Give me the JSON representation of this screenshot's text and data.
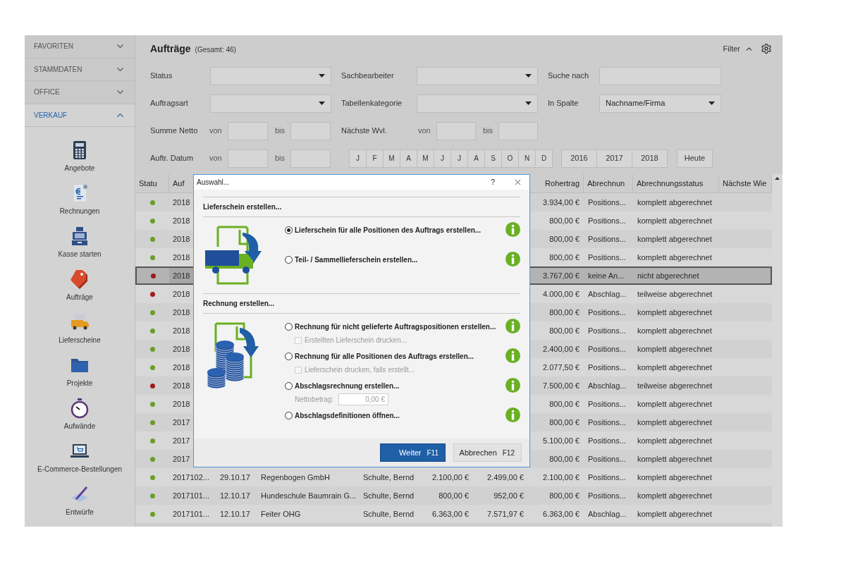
{
  "sidebar": {
    "sections": [
      {
        "label": "FAVORITEN",
        "expanded": false
      },
      {
        "label": "STAMMDATEN",
        "expanded": false
      },
      {
        "label": "OFFICE",
        "expanded": false
      },
      {
        "label": "VERKAUF",
        "expanded": true,
        "items": [
          {
            "label": "Angebote"
          },
          {
            "label": "Rechnungen"
          },
          {
            "label": "Kasse starten"
          },
          {
            "label": "Aufträge"
          },
          {
            "label": "Lieferscheine"
          },
          {
            "label": "Projekte"
          },
          {
            "label": "Aufwände"
          },
          {
            "label": "E-Commerce-Bestellungen"
          },
          {
            "label": "Entwürfe"
          }
        ]
      }
    ]
  },
  "header": {
    "title": "Aufträge",
    "count": "(Gesamt: 46)",
    "filter_label": "Filter"
  },
  "filters": {
    "rows": [
      [
        {
          "kind": "select",
          "label": "Status"
        },
        {
          "kind": "select",
          "label": "Sachbearbeiter"
        },
        {
          "kind": "text",
          "label": "Suche nach"
        }
      ],
      [
        {
          "kind": "select",
          "label": "Auftragsart"
        },
        {
          "kind": "select",
          "label": "Tabellenkategorie"
        },
        {
          "kind": "select",
          "label": "In Spalte",
          "value": "Nachname/Firma"
        }
      ],
      [
        {
          "kind": "range",
          "label": "Summe Netto",
          "from": "von",
          "to": "bis"
        },
        {
          "kind": "range",
          "label": "Nächste Wvl.",
          "from": "von",
          "to": "bis"
        }
      ],
      [
        {
          "kind": "range",
          "label": "Auftr. Datum",
          "from": "von",
          "to": "bis"
        },
        {
          "kind": "months",
          "items": [
            "J",
            "F",
            "M",
            "A",
            "M",
            "J",
            "J",
            "A",
            "S",
            "O",
            "N",
            "D"
          ]
        },
        {
          "kind": "years",
          "items": [
            "2016",
            "2017",
            "2018"
          ]
        },
        {
          "kind": "button",
          "label": "Heute"
        }
      ]
    ]
  },
  "table": {
    "status_column": "Statu",
    "columns": [
      "Auf",
      null,
      null,
      null,
      null,
      null,
      "Rohertrag",
      "Abrechnun",
      "Abrechnungsstatus",
      "Nächste Wie"
    ],
    "rows": [
      {
        "color": "#6a9e2a",
        "selected": false,
        "cells": [
          "2018",
          null,
          null,
          null,
          null,
          null,
          "3.934,00 €",
          "Positions...",
          "komplett abgerechnet"
        ]
      },
      {
        "color": "#6a9e2a",
        "selected": false,
        "cells": [
          "2018",
          null,
          null,
          null,
          null,
          null,
          "800,00 €",
          "Positions...",
          "komplett abgerechnet"
        ]
      },
      {
        "color": "#6a9e2a",
        "selected": false,
        "cells": [
          "2018",
          null,
          null,
          null,
          null,
          null,
          "800,00 €",
          "Positions...",
          "komplett abgerechnet"
        ]
      },
      {
        "color": "#6a9e2a",
        "selected": false,
        "cells": [
          "2018",
          null,
          null,
          null,
          null,
          null,
          "800,00 €",
          "Positions...",
          "komplett abgerechnet"
        ]
      },
      {
        "color": "#a31b1b",
        "selected": true,
        "cells": [
          "2018",
          null,
          null,
          null,
          null,
          null,
          "3.767,00 €",
          "keine An...",
          "nicht abgerechnet"
        ]
      },
      {
        "color": "#a31b1b",
        "selected": false,
        "cells": [
          "2018",
          null,
          null,
          null,
          null,
          null,
          "4.000,00 €",
          "Abschlag...",
          "teilweise abgerechnet"
        ]
      },
      {
        "color": "#6a9e2a",
        "selected": false,
        "cells": [
          "2018",
          null,
          null,
          null,
          null,
          null,
          "800,00 €",
          "Positions...",
          "komplett abgerechnet"
        ]
      },
      {
        "color": "#6a9e2a",
        "selected": false,
        "cells": [
          "2018",
          null,
          null,
          null,
          null,
          null,
          "800,00 €",
          "Positions...",
          "komplett abgerechnet"
        ]
      },
      {
        "color": "#6a9e2a",
        "selected": false,
        "cells": [
          "2018",
          null,
          null,
          null,
          null,
          null,
          "2.400,00 €",
          "Positions...",
          "komplett abgerechnet"
        ]
      },
      {
        "color": "#6a9e2a",
        "selected": false,
        "cells": [
          "2018",
          null,
          null,
          null,
          null,
          null,
          "2.077,50 €",
          "Positions...",
          "komplett abgerechnet"
        ]
      },
      {
        "color": "#a31b1b",
        "selected": false,
        "cells": [
          "2018",
          null,
          null,
          null,
          null,
          null,
          "7.500,00 €",
          "Abschlag...",
          "teilweise abgerechnet"
        ]
      },
      {
        "color": "#6a9e2a",
        "selected": false,
        "cells": [
          "2018",
          null,
          null,
          null,
          null,
          null,
          "800,00 €",
          "Positions...",
          "komplett abgerechnet"
        ]
      },
      {
        "color": "#6a9e2a",
        "selected": false,
        "cells": [
          "2017",
          null,
          null,
          null,
          null,
          null,
          "800,00 €",
          "Positions...",
          "komplett abgerechnet"
        ]
      },
      {
        "color": "#6a9e2a",
        "selected": false,
        "cells": [
          "2017",
          null,
          null,
          null,
          null,
          null,
          "5.100,00 €",
          "Positions...",
          "komplett abgerechnet"
        ]
      },
      {
        "color": "#6a9e2a",
        "selected": false,
        "cells": [
          "2017",
          null,
          null,
          null,
          null,
          null,
          "800,00 €",
          "Positions...",
          "komplett abgerechnet"
        ]
      },
      {
        "color": "#6a9e2a",
        "selected": false,
        "cells": [
          "2017102...",
          "29.10.17",
          "Regenbogen GmbH",
          "Schulte, Bernd",
          "2.100,00 €",
          "2.499,00 €",
          "2.100,00 €",
          "Positions...",
          "komplett abgerechnet"
        ]
      },
      {
        "color": "#6a9e2a",
        "selected": false,
        "cells": [
          "2017101...",
          "12.10.17",
          "Hundeschule Baumrain G...",
          "Schulte, Bernd",
          "800,00 €",
          "952,00 €",
          "800,00 €",
          "Positions...",
          "komplett abgerechnet"
        ]
      },
      {
        "color": "#6a9e2a",
        "selected": false,
        "cells": [
          "2017101...",
          "12.10.17",
          "Feiter OHG",
          "Schulte, Bernd",
          "6.363,00 €",
          "7.571,97 €",
          "6.363,00 €",
          "Abschlag...",
          "komplett abgerechnet"
        ]
      }
    ]
  },
  "dialog": {
    "title": "Auswahl...",
    "help": "?",
    "sections": [
      {
        "heading": "Lieferschein erstellen...",
        "options": [
          {
            "label": "Lieferschein für alle Positionen des Auftrags erstellen...",
            "selected": true
          },
          {
            "label": "Teil- / Sammellieferschein erstellen...",
            "selected": false
          }
        ]
      },
      {
        "heading": "Rechnung erstellen...",
        "options": [
          {
            "label": "Rechnung für nicht gelieferte Auftragspositionen erstellen...",
            "selected": false,
            "sub": {
              "kind": "checkbox",
              "label": "Erstellten Lieferschein drucken...",
              "checked": false,
              "disabled": true
            }
          },
          {
            "label": "Rechnung für alle Positionen des Auftrags erstellen...",
            "selected": false,
            "sub": {
              "kind": "checkbox",
              "label": "Lieferschein drucken, falls erstellt...",
              "checked": false,
              "disabled": true
            }
          },
          {
            "label": "Abschlagsrechnung erstellen...",
            "selected": false,
            "sub": {
              "kind": "amount",
              "label": "Nettobetrag:",
              "value": "0,00 €",
              "disabled": true
            }
          },
          {
            "label": "Abschlagsdefinitionen öffnen...",
            "selected": false
          }
        ]
      }
    ],
    "buttons": [
      {
        "kind": "primary",
        "label": "Weiter",
        "key": "F11"
      },
      {
        "kind": "secondary",
        "label": "Abbrechen",
        "key": "F12"
      }
    ]
  }
}
